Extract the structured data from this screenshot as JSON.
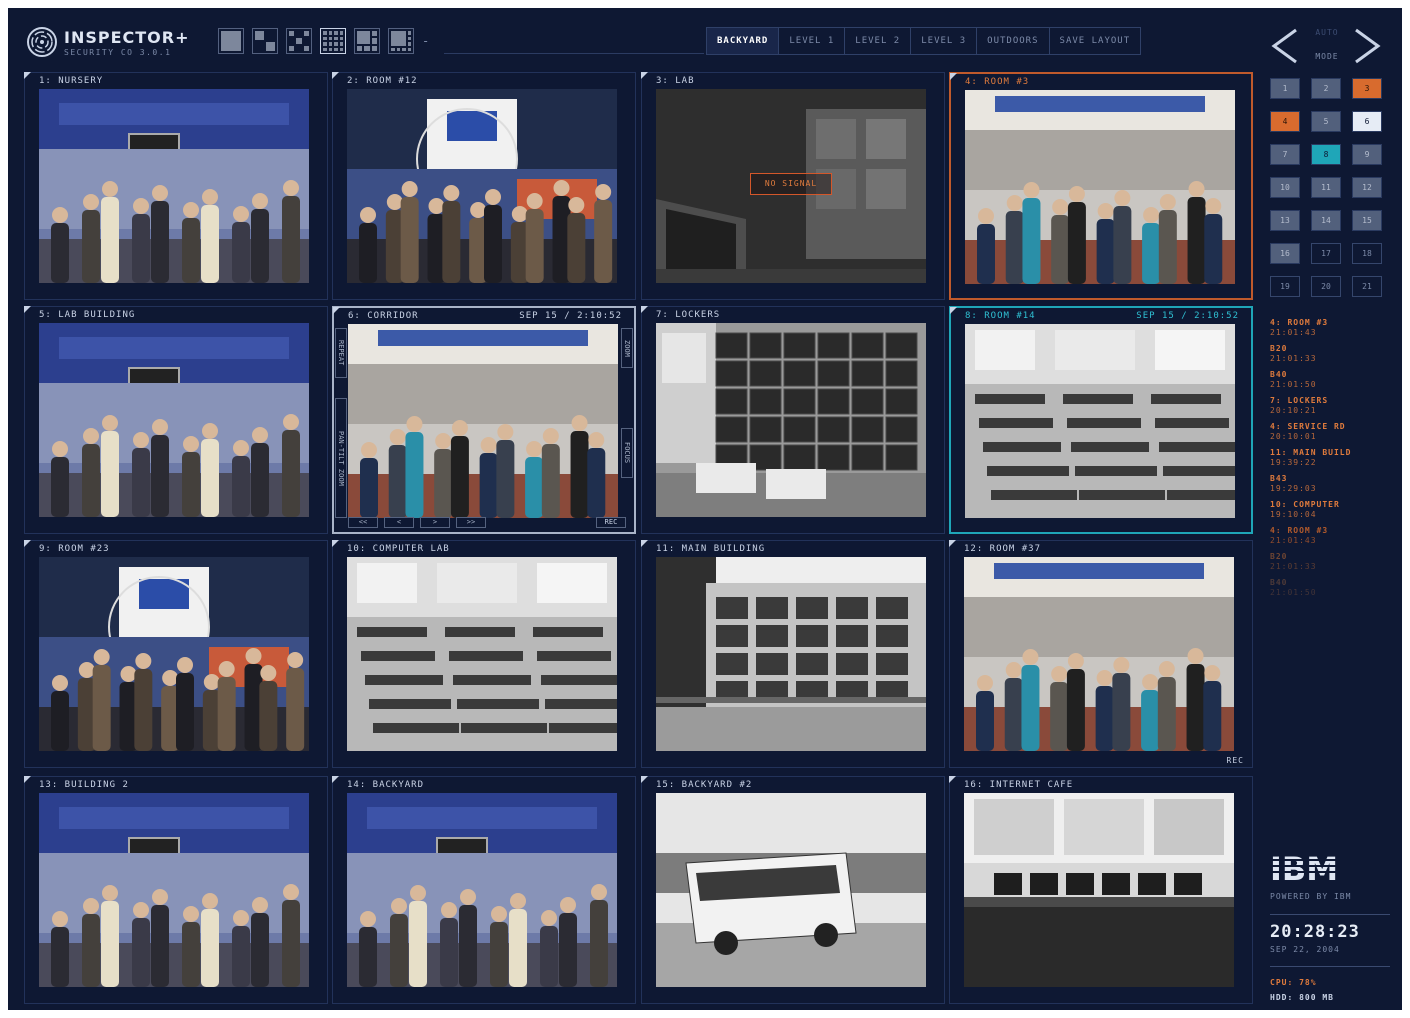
{
  "app": {
    "title": "INSPECTOR+",
    "subtitle": "SECURITY CO 3.0.1"
  },
  "layout_icons": [
    "layout-1x1",
    "layout-2x2",
    "layout-3x3",
    "layout-4x4",
    "layout-1plus5",
    "layout-1plus7"
  ],
  "layout_more": "-",
  "tabs": [
    "BACKYARD",
    "LEVEL 1",
    "LEVEL 2",
    "LEVEL 3",
    "OUTDOORS",
    "SAVE LAYOUT"
  ],
  "active_tab": "BACKYARD",
  "nav": {
    "auto_label": "AUTO",
    "mode_label": "MODE"
  },
  "cameras": [
    {
      "label": "1: NURSERY",
      "scene": "exhibit"
    },
    {
      "label": "2: ROOM #12",
      "scene": "booth"
    },
    {
      "label": "3: LAB",
      "scene": "dark",
      "motion_label": "NO SIGNAL"
    },
    {
      "label": "4: ROOM #3",
      "scene": "crowd",
      "state": "orange"
    },
    {
      "label": "5: LAB BUILDING",
      "scene": "exhibit"
    },
    {
      "label": "6: CORRIDOR",
      "scene": "crowd",
      "state": "white",
      "date": "SEP 15 / 2:10:52",
      "ptz": [
        "<<",
        "<",
        ">",
        ">>"
      ],
      "rec": "REC",
      "side_left": [
        "REPEAT",
        "PAN-TILT ZOOM"
      ],
      "side_right": [
        "ZOOM",
        "FOCUS"
      ]
    },
    {
      "label": "7: LOCKERS",
      "scene": "lockers"
    },
    {
      "label": "8: ROOM #14",
      "scene": "classroom",
      "state": "cyan",
      "date": "SEP 15 / 2:10:52"
    },
    {
      "label": "9: ROOM #23",
      "scene": "booth"
    },
    {
      "label": "10: COMPUTER LAB",
      "scene": "classroom"
    },
    {
      "label": "11: MAIN BUILDING",
      "scene": "building"
    },
    {
      "label": "12: ROOM #37",
      "scene": "crowd",
      "rec": "REC"
    },
    {
      "label": "13: BUILDING 2",
      "scene": "exhibit"
    },
    {
      "label": "14: BACKYARD",
      "scene": "exhibit"
    },
    {
      "label": "15: BACKYARD #2",
      "scene": "bus"
    },
    {
      "label": "16: INTERNET CAFE",
      "scene": "cafe"
    }
  ],
  "camera_buttons": [
    {
      "label": "1",
      "state": "filled"
    },
    {
      "label": "2",
      "state": "filled"
    },
    {
      "label": "3",
      "state": "orange"
    },
    {
      "label": "4",
      "state": "orange"
    },
    {
      "label": "5",
      "state": "filled"
    },
    {
      "label": "6",
      "state": "white"
    },
    {
      "label": "7",
      "state": "filled"
    },
    {
      "label": "8",
      "state": "cyan"
    },
    {
      "label": "9",
      "state": "filled"
    },
    {
      "label": "10",
      "state": "filled"
    },
    {
      "label": "11",
      "state": "filled"
    },
    {
      "label": "12",
      "state": "filled"
    },
    {
      "label": "13",
      "state": "filled"
    },
    {
      "label": "14",
      "state": "filled"
    },
    {
      "label": "15",
      "state": "filled"
    },
    {
      "label": "16",
      "state": "filled"
    },
    {
      "label": "17",
      "state": "dark"
    },
    {
      "label": "18",
      "state": "dark"
    },
    {
      "label": "19",
      "state": "dark"
    },
    {
      "label": "20",
      "state": "dark"
    },
    {
      "label": "21",
      "state": "dark"
    }
  ],
  "events": [
    {
      "name": "4: ROOM #3",
      "time": "21:01:43",
      "color": "#e07b3d"
    },
    {
      "name": "B20",
      "time": "21:01:33",
      "color": "#e07b3d"
    },
    {
      "name": "B40",
      "time": "21:01:50",
      "color": "#e07b3d"
    },
    {
      "name": "7: LOCKERS",
      "time": "20:10:21",
      "color": "#e07b3d"
    },
    {
      "name": "4: SERVICE RD",
      "time": "20:10:01",
      "color": "#e07b3d"
    },
    {
      "name": "11: MAIN BUILD",
      "time": "19:39:22",
      "color": "#e07b3d"
    },
    {
      "name": "B43",
      "time": "19:29:03",
      "color": "#e07b3d"
    },
    {
      "name": "10: COMPUTER",
      "time": "19:10:04",
      "color": "#e07b3d"
    },
    {
      "name": "4: ROOM #3",
      "time": "21:01:43",
      "color": "#b25a2c"
    },
    {
      "name": "B20",
      "time": "21:01:33",
      "color": "#6e4532"
    },
    {
      "name": "B40",
      "time": "21:01:50",
      "color": "#4e3a38"
    }
  ],
  "branding": {
    "logo": "IBM",
    "powered": "POWERED BY IBM"
  },
  "clock": {
    "time": "20:28:23",
    "date": "SEP 22, 2004"
  },
  "system": {
    "cpu": "CPU: 78%",
    "hdd": "HDD: 800 MB"
  },
  "colors": {
    "background": "#0e1833",
    "accent_orange": "#e07b3d",
    "accent_cyan": "#1fa6b8"
  }
}
